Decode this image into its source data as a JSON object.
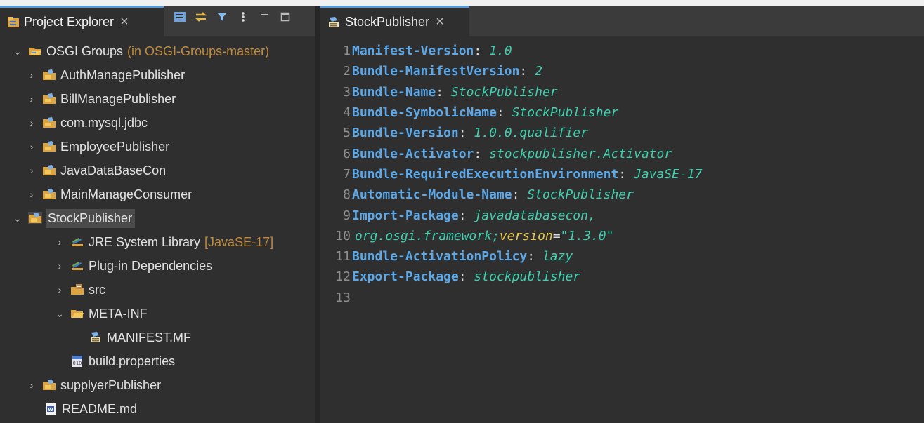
{
  "explorer": {
    "tab_title": "Project Explorer",
    "close_glyph": "×",
    "tree": [
      {
        "label": "OSGI Groups",
        "decoration": "(in OSGI-Groups-master)",
        "icon": "working-set-folder-icon",
        "expanded": true
      },
      {
        "label": "AuthManagePublisher",
        "icon": "plugin-project-icon"
      },
      {
        "label": "BillManagePublisher",
        "icon": "plugin-project-icon"
      },
      {
        "label": "com.mysql.jdbc",
        "icon": "plugin-project-icon"
      },
      {
        "label": "EmployeePublisher",
        "icon": "plugin-project-icon"
      },
      {
        "label": "JavaDataBaseCon",
        "icon": "plugin-project-icon"
      },
      {
        "label": "MainManageConsumer",
        "icon": "plugin-project-icon"
      },
      {
        "label": "StockPublisher",
        "icon": "plugin-project-icon",
        "expanded": true,
        "selected": true
      },
      {
        "label": "JRE System Library",
        "decoration": "[JavaSE-17]",
        "icon": "library-icon"
      },
      {
        "label": "Plug-in Dependencies",
        "icon": "library-icon"
      },
      {
        "label": "src",
        "icon": "source-folder-icon"
      },
      {
        "label": "META-INF",
        "icon": "folder-icon",
        "expanded": true
      },
      {
        "label": "MANIFEST.MF",
        "icon": "manifest-file-icon"
      },
      {
        "label": "build.properties",
        "icon": "properties-file-icon"
      },
      {
        "label": "supplyerPublisher",
        "icon": "plugin-project-icon"
      },
      {
        "label": "README.md",
        "icon": "markdown-file-icon"
      }
    ]
  },
  "editor": {
    "tab_title": "StockPublisher",
    "close_glyph": "×",
    "lines": [
      {
        "n": "1",
        "key": "Manifest-Version",
        "value": "1.0"
      },
      {
        "n": "2",
        "key": "Bundle-ManifestVersion",
        "value": "2"
      },
      {
        "n": "3",
        "key": "Bundle-Name",
        "value": "StockPublisher"
      },
      {
        "n": "4",
        "key": "Bundle-SymbolicName",
        "value": "StockPublisher"
      },
      {
        "n": "5",
        "key": "Bundle-Version",
        "value": "1.0.0.qualifier"
      },
      {
        "n": "6",
        "key": "Bundle-Activator",
        "value": "stockpublisher.Activator"
      },
      {
        "n": "7",
        "key": "Bundle-RequiredExecutionEnvironment",
        "value": "JavaSE-17"
      },
      {
        "n": "8",
        "key": "Automatic-Module-Name",
        "value": "StockPublisher"
      },
      {
        "n": "9",
        "key": "Import-Package",
        "value": "javadatabasecon,"
      },
      {
        "n": "10",
        "cont_value": "org.osgi.framework;",
        "attr": "version",
        "eq": "=",
        "attr_value": "\"1.3.0\""
      },
      {
        "n": "11",
        "key": "Bundle-ActivationPolicy",
        "value": "lazy"
      },
      {
        "n": "12",
        "key": "Export-Package",
        "value": "stockpublisher"
      },
      {
        "n": "13"
      }
    ]
  }
}
